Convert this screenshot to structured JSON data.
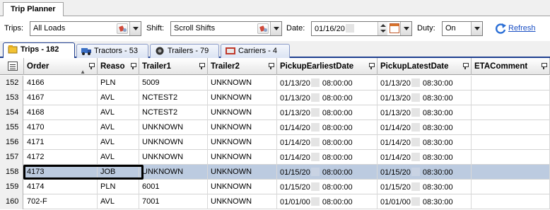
{
  "window_tab": "Trip Planner",
  "toolbar": {
    "trips_label": "Trips:",
    "trips_value": "All Loads",
    "shift_label": "Shift:",
    "shift_value": "Scroll Shifts",
    "date_label": "Date:",
    "date_value": "01/16/20",
    "duty_label": "Duty:",
    "duty_value": "On",
    "refresh_label": "Refresh"
  },
  "tabs": [
    {
      "label": "Trips - 182",
      "icon": "trips-icon",
      "active": true
    },
    {
      "label": "Tractors - 53",
      "icon": "tractor-icon",
      "active": false
    },
    {
      "label": "Trailers - 79",
      "icon": "trailer-icon",
      "active": false
    },
    {
      "label": "Carriers - 4",
      "icon": "carrier-icon",
      "active": false
    }
  ],
  "columns": [
    "Order",
    "Reaso",
    "Trailer1",
    "Trailer2",
    "PickupEarliestDate",
    "PickupLatestDate",
    "ETAComment"
  ],
  "sorted_column": "Order",
  "rows": [
    {
      "num": "152",
      "order": "4166",
      "reason": "PLN",
      "trailer1": "5009",
      "trailer2": "UNKNOWN",
      "pe_date": "01/13/20",
      "pe_time": "08:00:00",
      "pl_date": "01/13/20",
      "pl_time": "08:30:00",
      "eta": ""
    },
    {
      "num": "153",
      "order": "4167",
      "reason": "AVL",
      "trailer1": "NCTEST2",
      "trailer2": "UNKNOWN",
      "pe_date": "01/13/20",
      "pe_time": "08:00:00",
      "pl_date": "01/13/20",
      "pl_time": "08:30:00",
      "eta": ""
    },
    {
      "num": "154",
      "order": "4168",
      "reason": "AVL",
      "trailer1": "NCTEST2",
      "trailer2": "UNKNOWN",
      "pe_date": "01/13/20",
      "pe_time": "08:00:00",
      "pl_date": "01/13/20",
      "pl_time": "08:30:00",
      "eta": ""
    },
    {
      "num": "155",
      "order": "4170",
      "reason": "AVL",
      "trailer1": "UNKNOWN",
      "trailer2": "UNKNOWN",
      "pe_date": "01/14/20",
      "pe_time": "08:00:00",
      "pl_date": "01/14/20",
      "pl_time": "08:30:00",
      "eta": ""
    },
    {
      "num": "156",
      "order": "4171",
      "reason": "AVL",
      "trailer1": "UNKNOWN",
      "trailer2": "UNKNOWN",
      "pe_date": "01/14/20",
      "pe_time": "08:00:00",
      "pl_date": "01/14/20",
      "pl_time": "08:30:00",
      "eta": ""
    },
    {
      "num": "157",
      "order": "4172",
      "reason": "AVL",
      "trailer1": "UNKNOWN",
      "trailer2": "UNKNOWN",
      "pe_date": "01/14/20",
      "pe_time": "08:00:00",
      "pl_date": "01/14/20",
      "pl_time": "08:30:00",
      "eta": ""
    },
    {
      "num": "158",
      "order": "4173",
      "reason": "JOB",
      "trailer1": "UNKNOWN",
      "trailer2": "UNKNOWN",
      "pe_date": "01/15/20",
      "pe_time": "08:00:00",
      "pl_date": "01/15/20",
      "pl_time": "08:30:00",
      "eta": "",
      "selected": true
    },
    {
      "num": "159",
      "order": "4174",
      "reason": "PLN",
      "trailer1": "6001",
      "trailer2": "UNKNOWN",
      "pe_date": "01/15/20",
      "pe_time": "08:00:00",
      "pl_date": "01/15/20",
      "pl_time": "08:30:00",
      "eta": ""
    },
    {
      "num": "160",
      "order": "702-F",
      "reason": "AVL",
      "trailer1": "7001",
      "trailer2": "UNKNOWN",
      "pe_date": "01/01/00",
      "pe_time": "08:00:00",
      "pl_date": "01/01/00",
      "pl_time": "08:30:00",
      "eta": ""
    }
  ],
  "colors": {
    "accent": "#1f3f8f",
    "selected_row": "#bccbe0",
    "link": "#1a4fc4"
  }
}
